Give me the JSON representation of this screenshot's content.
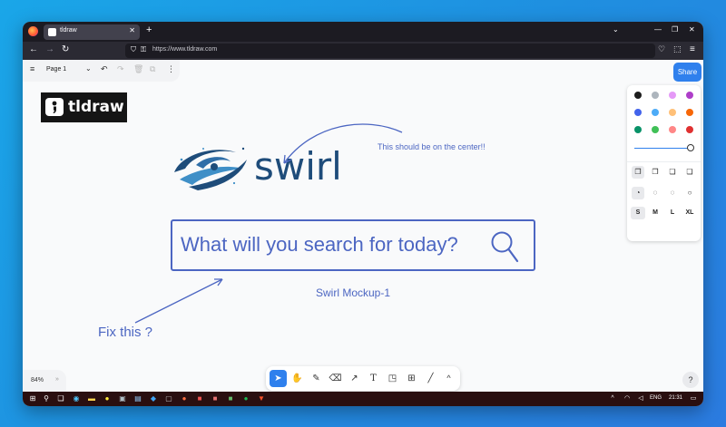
{
  "browser": {
    "tab_title": "tldraw",
    "tab_close": "✕",
    "new_tab": "+",
    "url": "https://www.tldraw.com"
  },
  "tldraw": {
    "page_name": "Page 1",
    "share_label": "Share",
    "zoom": "84%",
    "help": "?",
    "sizes": [
      "S",
      "M",
      "L",
      "XL"
    ],
    "colors": [
      "#1d1d1d",
      "#adb5bd",
      "#e599f7",
      "#ae3ec9",
      "#4263eb",
      "#4dabf7",
      "#ffc078",
      "#f76707",
      "#099268",
      "#40c057",
      "#ff8787",
      "#e03131"
    ],
    "logo_text": "tldraw"
  },
  "canvas": {
    "swirl_word": "swirl",
    "search_prompt": "What will you search for today?",
    "mockup_label": "Swirl Mockup-1",
    "note_center": "This should be on the center!!",
    "note_fix": "Fix this ?"
  },
  "taskbar": {
    "language": "ENG",
    "time": "21:31"
  }
}
